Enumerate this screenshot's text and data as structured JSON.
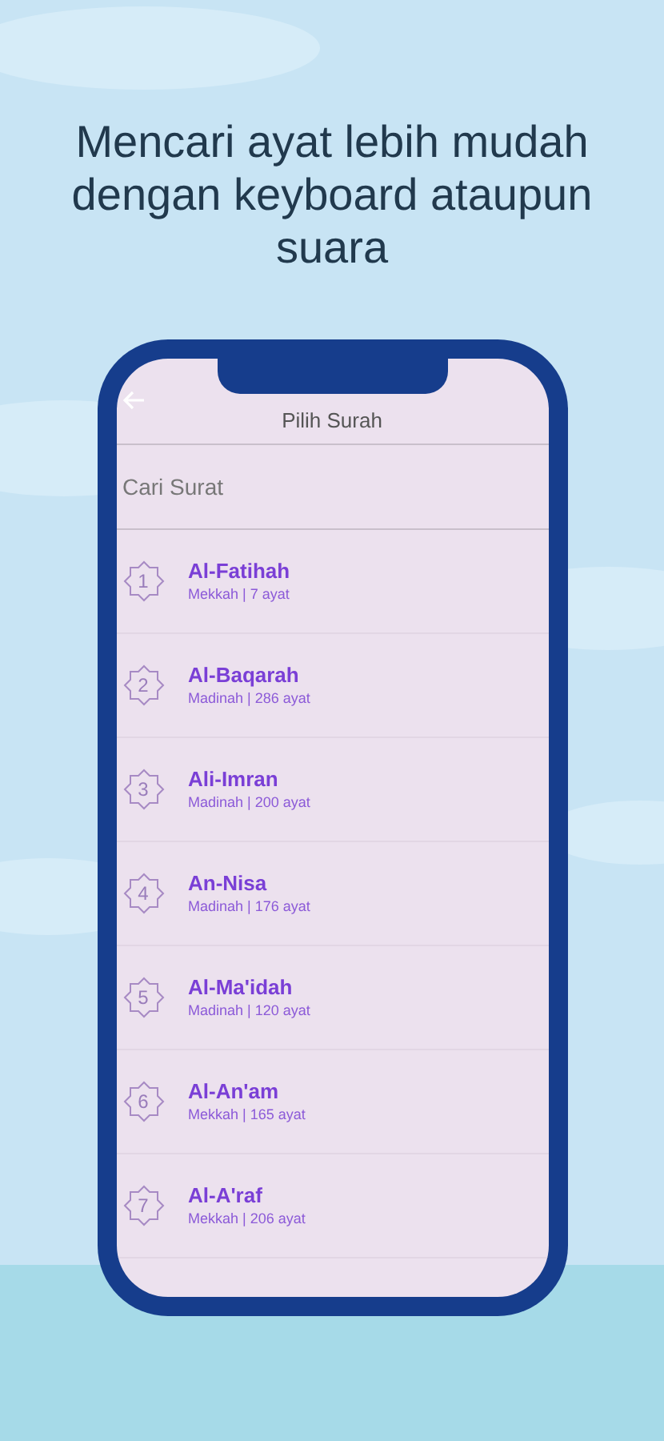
{
  "headline": "Mencari ayat lebih mudah dengan keyboard ataupun suara",
  "app_bar": {
    "title": "Pilih Surah"
  },
  "search": {
    "placeholder": "Cari Surat"
  },
  "surahs": [
    {
      "number": "1",
      "name": "Al-Fatihah",
      "info": "Mekkah | 7 ayat"
    },
    {
      "number": "2",
      "name": "Al-Baqarah",
      "info": "Madinah | 286 ayat"
    },
    {
      "number": "3",
      "name": "Ali-Imran",
      "info": "Madinah | 200 ayat"
    },
    {
      "number": "4",
      "name": "An-Nisa",
      "info": "Madinah | 176 ayat"
    },
    {
      "number": "5",
      "name": "Al-Ma'idah",
      "info": "Madinah | 120 ayat"
    },
    {
      "number": "6",
      "name": "Al-An'am",
      "info": "Mekkah | 165 ayat"
    },
    {
      "number": "7",
      "name": "Al-A'raf",
      "info": "Mekkah | 206 ayat"
    }
  ]
}
